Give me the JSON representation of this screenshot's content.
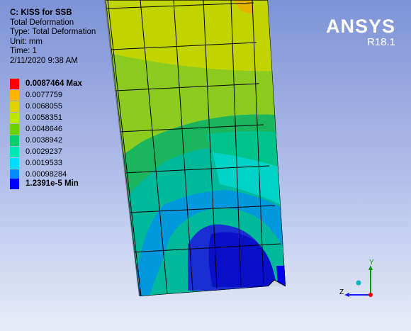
{
  "info": {
    "title": "C: KISS for SSB",
    "lines": [
      "Total Deformation",
      "Type: Total Deformation",
      "Unit: mm",
      "Time: 1",
      "2/11/2020 9:38 AM"
    ]
  },
  "legend": {
    "labels": [
      "0.0087464 Max",
      "0.0077759",
      "0.0068055",
      "0.0058351",
      "0.0048646",
      "0.0038942",
      "0.0029237",
      "0.0019533",
      "0.00098284",
      "1.2391e-5 Min"
    ],
    "colors": [
      "#ff0000",
      "#ffb400",
      "#e1d200",
      "#bde600",
      "#6ed200",
      "#00cf6b",
      "#00e6b4",
      "#00dcff",
      "#008cff",
      "#0000ff"
    ]
  },
  "brand": {
    "name": "ANSYS",
    "version": "R18.1"
  },
  "triad": {
    "y_label": "Y",
    "z_label": "Z"
  }
}
